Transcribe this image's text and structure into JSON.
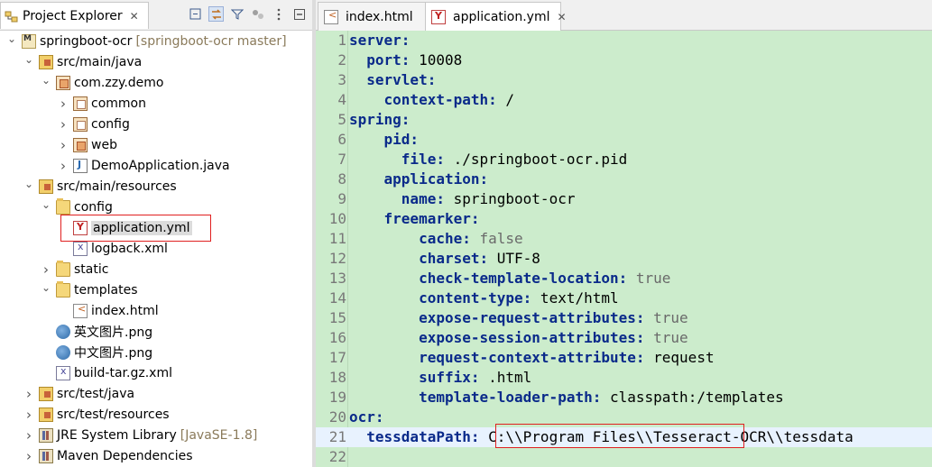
{
  "explorer": {
    "title": "Project Explorer",
    "close_symbol": "✕",
    "toolbar": [
      "collapse-all-icon",
      "link-with-editor-icon",
      "filter-icon",
      "focus-icon",
      "view-menu-icon",
      "minimize-icon"
    ],
    "tree": [
      {
        "label": "springboot-ocr",
        "decor": "[springboot-ocr master]",
        "icon": "project-icon",
        "twisty": "open"
      },
      {
        "label": "src/main/java",
        "icon": "source-folder-icon",
        "twisty": "open"
      },
      {
        "label": "com.zzy.demo",
        "icon": "package-icon",
        "twisty": "open"
      },
      {
        "label": "common",
        "icon": "package-icon",
        "twisty": "closed"
      },
      {
        "label": "config",
        "icon": "package-icon",
        "twisty": "closed"
      },
      {
        "label": "web",
        "icon": "package-icon",
        "twisty": "closed"
      },
      {
        "label": "DemoApplication.java",
        "icon": "java-file-icon",
        "twisty": "closed"
      },
      {
        "label": "src/main/resources",
        "icon": "source-folder-icon",
        "twisty": "open"
      },
      {
        "label": "config",
        "icon": "folder-icon",
        "twisty": "open"
      },
      {
        "label": "application.yml",
        "icon": "yml-file-icon",
        "twisty": "none"
      },
      {
        "label": "logback.xml",
        "icon": "xml-file-icon",
        "twisty": "none"
      },
      {
        "label": "static",
        "icon": "folder-icon",
        "twisty": "closed"
      },
      {
        "label": "templates",
        "icon": "folder-icon",
        "twisty": "open"
      },
      {
        "label": "index.html",
        "icon": "html-file-icon",
        "twisty": "none"
      },
      {
        "label": "英文图片.png",
        "icon": "image-file-icon",
        "twisty": "none"
      },
      {
        "label": "中文图片.png",
        "icon": "image-file-icon",
        "twisty": "none"
      },
      {
        "label": "build-tar.gz.xml",
        "icon": "xml-file-icon",
        "twisty": "none"
      },
      {
        "label": "src/test/java",
        "icon": "source-folder-icon",
        "twisty": "closed"
      },
      {
        "label": "src/test/resources",
        "icon": "source-folder-icon",
        "twisty": "closed"
      },
      {
        "label": "JRE System Library",
        "decor": "[JavaSE-1.8]",
        "icon": "library-icon",
        "twisty": "closed"
      },
      {
        "label": "Maven Dependencies",
        "icon": "library-icon",
        "twisty": "closed"
      }
    ],
    "selected_item": "application.yml"
  },
  "editor": {
    "tabs": [
      {
        "label": "index.html",
        "icon": "html-file-icon",
        "active": false
      },
      {
        "label": "application.yml",
        "icon": "yml-file-icon",
        "active": true,
        "close_symbol": "✕"
      }
    ],
    "current_line": 21,
    "lines": [
      {
        "n": "1",
        "indent": "",
        "key": "server:",
        "value": ""
      },
      {
        "n": "2",
        "indent": "  ",
        "key": "port:",
        "value": " 10008"
      },
      {
        "n": "3",
        "indent": "  ",
        "key": "servlet:",
        "value": ""
      },
      {
        "n": "4",
        "indent": "    ",
        "key": "context-path:",
        "value": " /"
      },
      {
        "n": "5",
        "indent": "",
        "key": "spring:",
        "value": ""
      },
      {
        "n": "6",
        "indent": "    ",
        "key": "pid:",
        "value": ""
      },
      {
        "n": "7",
        "indent": "      ",
        "key": "file:",
        "value": " ./springboot-ocr.pid"
      },
      {
        "n": "8",
        "indent": "    ",
        "key": "application:",
        "value": ""
      },
      {
        "n": "9",
        "indent": "      ",
        "key": "name:",
        "value": " springboot-ocr"
      },
      {
        "n": "10",
        "indent": "    ",
        "key": "freemarker:",
        "value": ""
      },
      {
        "n": "11",
        "indent": "        ",
        "key": "cache:",
        "value": " false",
        "bool": true
      },
      {
        "n": "12",
        "indent": "        ",
        "key": "charset:",
        "value": " UTF-8"
      },
      {
        "n": "13",
        "indent": "        ",
        "key": "check-template-location:",
        "value": " true",
        "bool": true
      },
      {
        "n": "14",
        "indent": "        ",
        "key": "content-type:",
        "value": " text/html"
      },
      {
        "n": "15",
        "indent": "        ",
        "key": "expose-request-attributes:",
        "value": " true",
        "bool": true
      },
      {
        "n": "16",
        "indent": "        ",
        "key": "expose-session-attributes:",
        "value": " true",
        "bool": true
      },
      {
        "n": "17",
        "indent": "        ",
        "key": "request-context-attribute:",
        "value": " request"
      },
      {
        "n": "18",
        "indent": "        ",
        "key": "suffix:",
        "value": " .html"
      },
      {
        "n": "19",
        "indent": "        ",
        "key": "template-loader-path:",
        "value": " classpath:/templates"
      },
      {
        "n": "20",
        "indent": "",
        "key": "ocr:",
        "value": ""
      },
      {
        "n": "21",
        "indent": "  ",
        "key": "tessdataPath:",
        "value": " C:\\\\Program Files\\\\Tesseract-OCR\\\\tessdata"
      },
      {
        "n": "22",
        "indent": "",
        "key": "",
        "value": ""
      }
    ]
  },
  "colors": {
    "editor_background": "#cceccc",
    "key_color": "#0a2a8a",
    "highlight_box": "#e02020",
    "current_line": "#e8f2fe"
  }
}
